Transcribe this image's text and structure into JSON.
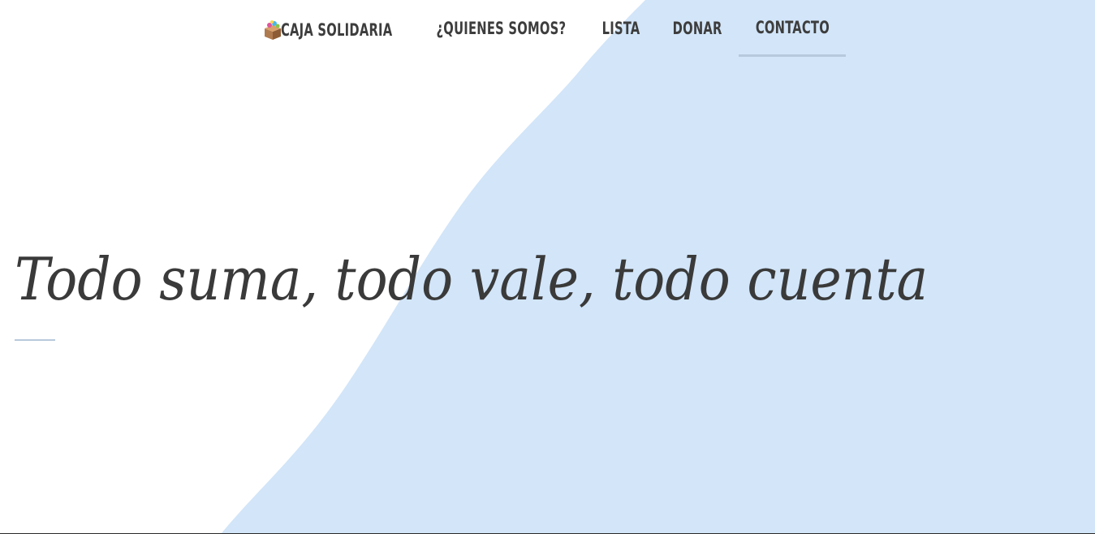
{
  "nav": {
    "brand_label": "CAJA SOLIDARIA",
    "brand_icon": "gift-box-icon",
    "items": [
      {
        "label": "¿QUIENES SOMOS?"
      },
      {
        "label": "LISTA"
      },
      {
        "label": "DONAR"
      },
      {
        "label": "CONTACTO",
        "active": true
      }
    ]
  },
  "hero": {
    "title": "Todo suma, todo vale, todo cuenta"
  },
  "colors": {
    "background": "#ffffff",
    "accent_blue": "#d2e5f9",
    "underline": "#b7c9dc",
    "text": "#3d3d3d"
  }
}
